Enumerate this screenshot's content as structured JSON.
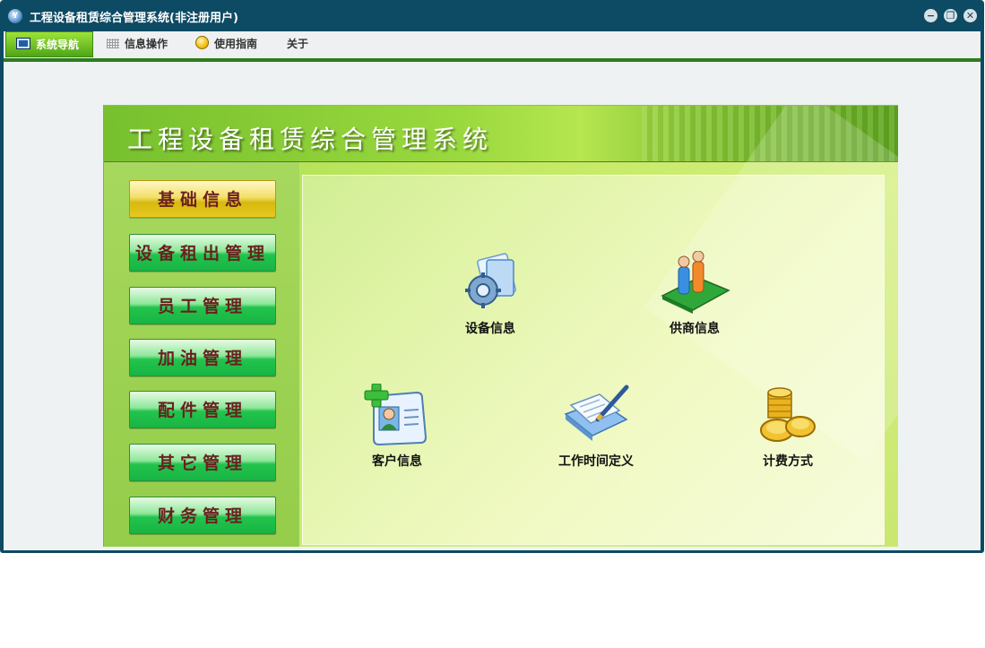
{
  "window": {
    "title": "工程设备租赁综合管理系统(非注册用户)",
    "app_icon_text": "Y",
    "controls": {
      "minimize": "−",
      "restore": "❐",
      "close": "✕"
    }
  },
  "menu": {
    "items": [
      {
        "label": "系统导航",
        "active": true,
        "icon": "monitor-icon"
      },
      {
        "label": "信息操作",
        "active": false,
        "icon": "grid-icon"
      },
      {
        "label": "使用指南",
        "active": false,
        "icon": "help-icon"
      },
      {
        "label": "关于",
        "active": false
      }
    ]
  },
  "panel": {
    "title": "工程设备租赁综合管理系统"
  },
  "sidebar": {
    "buttons": [
      {
        "label": "基础信息",
        "selected": true
      },
      {
        "label": "设备租出管理",
        "selected": false
      },
      {
        "label": "员工管理",
        "selected": false
      },
      {
        "label": "加油管理",
        "selected": false
      },
      {
        "label": "配件管理",
        "selected": false
      },
      {
        "label": "其它管理",
        "selected": false
      },
      {
        "label": "财务管理",
        "selected": false
      }
    ]
  },
  "tiles": [
    {
      "label": "设备信息",
      "icon": "gear-folder-icon"
    },
    {
      "label": "供商信息",
      "icon": "people-book-icon"
    },
    {
      "label": "客户信息",
      "icon": "contact-card-icon"
    },
    {
      "label": "工作时间定义",
      "icon": "notebook-pen-icon"
    },
    {
      "label": "计费方式",
      "icon": "gold-coins-icon"
    }
  ],
  "colors": {
    "window_frame": "#0d4a63",
    "menu_active": "#4fa517",
    "nav_button": "#22c44c",
    "nav_selected": "#d6b80f",
    "nav_text": "#6a1f1f"
  }
}
